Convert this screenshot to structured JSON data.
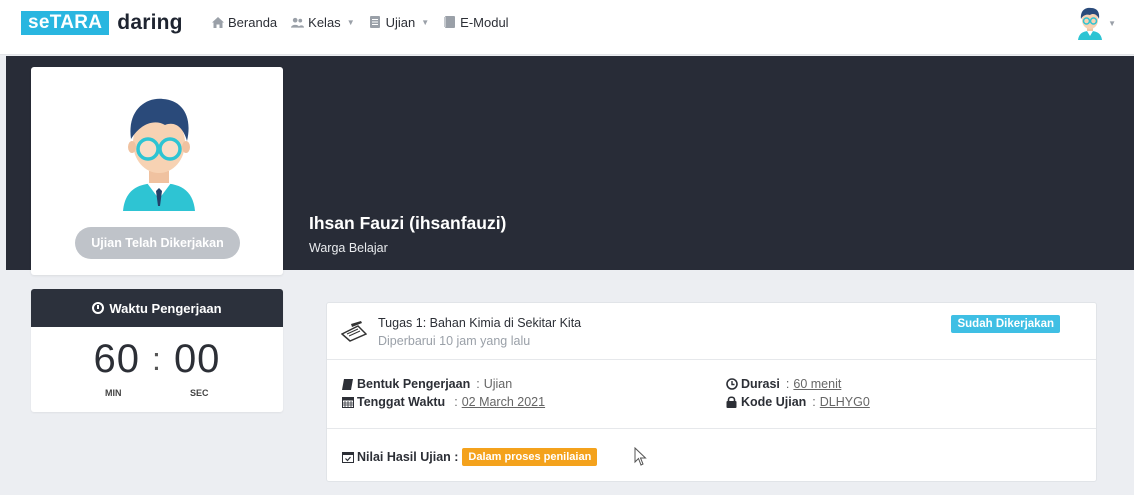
{
  "brand": {
    "logo_prefix": "seTARA",
    "logo_suffix": "daring"
  },
  "nav": {
    "items": [
      {
        "label": "Beranda",
        "icon": "home-icon"
      },
      {
        "label": "Kelas",
        "icon": "users-icon",
        "dropdown": true
      },
      {
        "label": "Ujian",
        "icon": "document-icon",
        "dropdown": true
      },
      {
        "label": "E-Modul",
        "icon": "book-icon"
      }
    ]
  },
  "profile": {
    "name": "Ihsan Fauzi (ihsanfauzi)",
    "role": "Warga Belajar",
    "status_button": "Ujian Telah Dikerjakan"
  },
  "timer": {
    "title": "Waktu Pengerjaan",
    "minutes": "60",
    "separator": ":",
    "seconds": "00",
    "min_label": "MIN",
    "sec_label": "SEC"
  },
  "task": {
    "title": "Tugas 1: Bahan Kimia di Sekitar Kita",
    "updated": "Diperbarui 10 jam yang lalu",
    "status_badge": "Sudah Dikerjakan",
    "bentuk_label": "Bentuk Pengerjaan",
    "bentuk_value": "Ujian",
    "tenggat_label": "Tenggat Waktu",
    "tenggat_value": "02 March 2021",
    "durasi_label": "Durasi",
    "durasi_value": "60 menit",
    "kode_label": "Kode Ujian",
    "kode_value": "DLHYG0",
    "nilai_label": "Nilai Hasil Ujian :",
    "nilai_badge": "Dalam proses penilaian",
    "colon": ":"
  },
  "colors": {
    "brand_blue": "#29b6e0",
    "hero_dark": "#282c37",
    "done_badge": "#3fbfe4",
    "waiting_badge": "#f4a21c",
    "status_button_gray": "#bfc3c9"
  }
}
